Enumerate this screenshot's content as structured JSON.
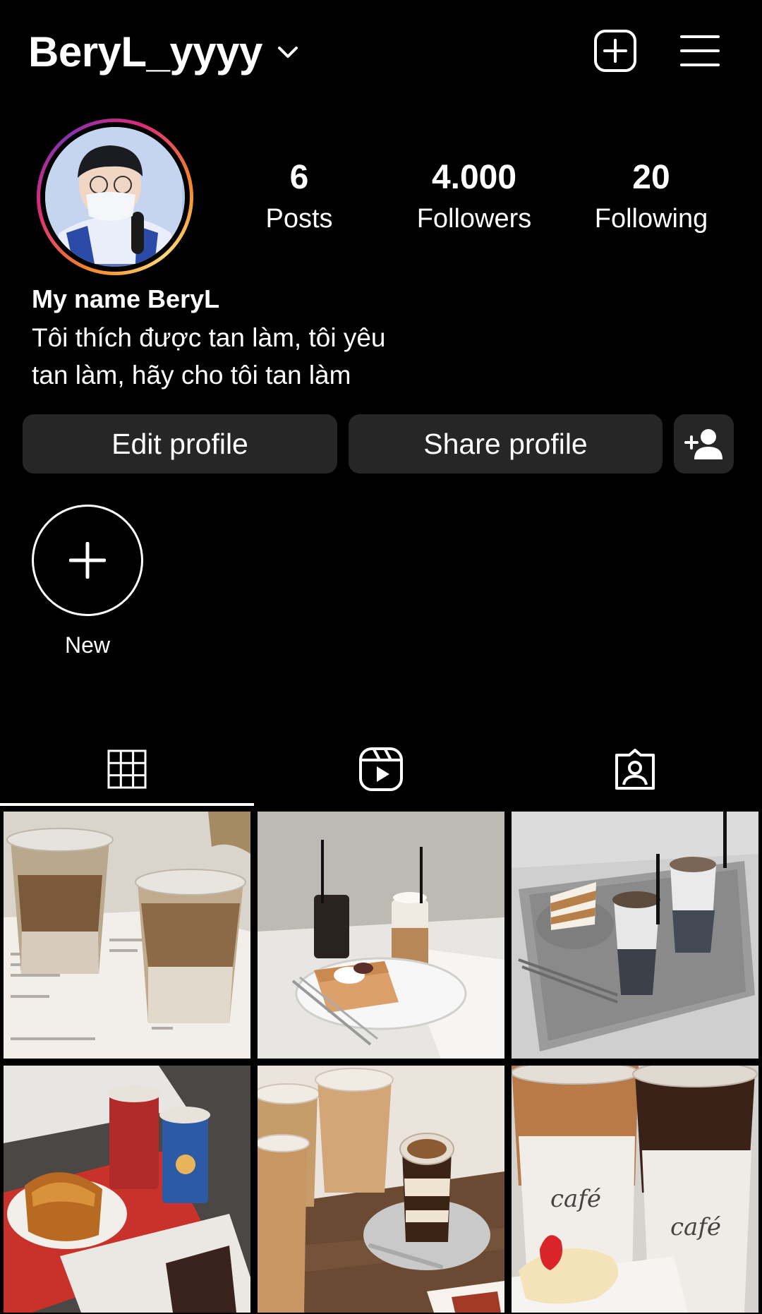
{
  "header": {
    "username": "BeryL_yyyy",
    "chevron_icon": "chevron-down-icon",
    "create_icon": "plus-square-icon",
    "menu_icon": "hamburger-menu-icon"
  },
  "profile": {
    "display_name": "My name BeryL",
    "bio_line1": "Tôi thích được tan làm, tôi yêu",
    "bio_line2": "tan làm, hãy cho tôi tan làm",
    "stats": {
      "posts_count": "6",
      "posts_label": "Posts",
      "followers_count": "4.000",
      "followers_label": "Followers",
      "following_count": "20",
      "following_label": "Following"
    }
  },
  "actions": {
    "edit_label": "Edit profile",
    "share_label": "Share profile",
    "add_user_icon": "person-add-icon"
  },
  "highlights": {
    "new_label": "New"
  },
  "tabs": {
    "active": "grid",
    "items": [
      "grid-icon",
      "reels-icon",
      "tagged-icon"
    ]
  },
  "posts": {
    "count": 6,
    "captions": [
      "",
      "",
      "",
      "",
      "",
      ""
    ]
  },
  "colors": {
    "background": "#000000",
    "button_bg": "#262626",
    "text": "#ffffff"
  }
}
